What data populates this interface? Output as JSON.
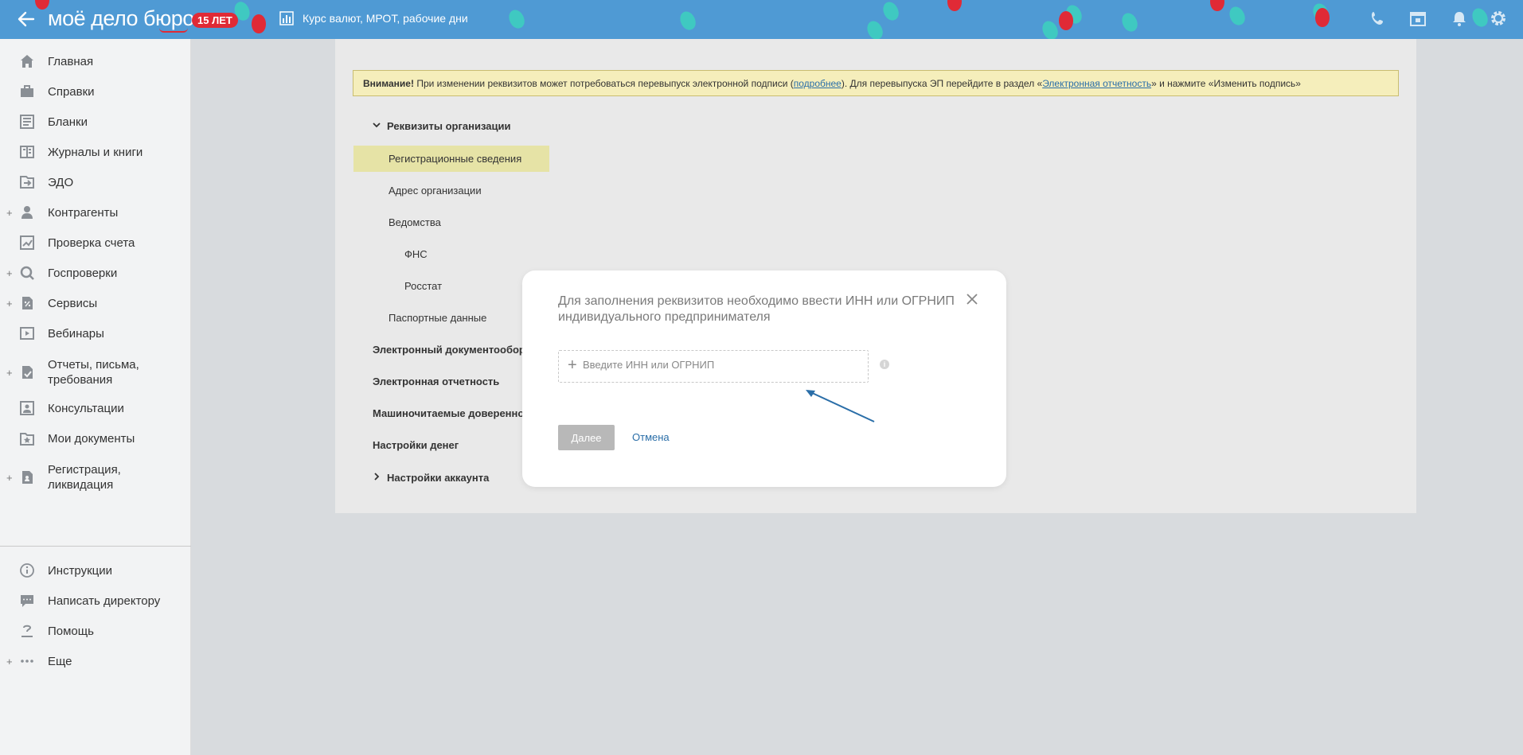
{
  "header": {
    "logo": "моё дело бюро",
    "anniversary_badge": "15 ЛЕТ",
    "link_label": "Курс валют, МРОТ, рабочие дни",
    "icons": [
      "back-arrow-icon",
      "chart-icon",
      "phone-icon",
      "calendar-icon",
      "bell-icon",
      "gear-icon"
    ]
  },
  "sidebar": {
    "items": [
      {
        "label": "Главная",
        "icon": "home-icon",
        "expandable": false
      },
      {
        "label": "Справки",
        "icon": "briefcase-icon",
        "expandable": false
      },
      {
        "label": "Бланки",
        "icon": "forms-icon",
        "expandable": false
      },
      {
        "label": "Журналы и книги",
        "icon": "journal-icon",
        "expandable": false
      },
      {
        "label": "ЭДО",
        "icon": "edo-icon",
        "expandable": false
      },
      {
        "label": "Контрагенты",
        "icon": "person-icon",
        "expandable": true
      },
      {
        "label": "Проверка счета",
        "icon": "account-check-icon",
        "expandable": false
      },
      {
        "label": "Госпроверки",
        "icon": "magnifier-icon",
        "expandable": true
      },
      {
        "label": "Сервисы",
        "icon": "percent-doc-icon",
        "expandable": true
      },
      {
        "label": "Вебинары",
        "icon": "video-icon",
        "expandable": false
      },
      {
        "label": "Отчеты, письма, требования",
        "icon": "report-icon",
        "expandable": true
      },
      {
        "label": "Консультации",
        "icon": "consult-icon",
        "expandable": false
      },
      {
        "label": "Мои документы",
        "icon": "folder-star-icon",
        "expandable": false
      },
      {
        "label": "Регистрация, ликвидация",
        "icon": "registration-icon",
        "expandable": true
      }
    ],
    "bottom_items": [
      {
        "label": "Инструкции",
        "icon": "info-circle-icon",
        "expandable": false
      },
      {
        "label": "Написать директору",
        "icon": "message-icon",
        "expandable": false
      },
      {
        "label": "Помощь",
        "icon": "help-icon",
        "expandable": false
      },
      {
        "label": "Еще",
        "icon": "more-dots-icon",
        "expandable": true
      }
    ]
  },
  "warning": {
    "bold": "Внимание!",
    "text1": " При изменении реквизитов может потребоваться перевыпуск электронной подписи (",
    "link1": "подробнее",
    "text2": "). Для перевыпуска ЭП перейдите в раздел «",
    "link2": "Электронная отчетность",
    "text3": "» и нажмите «Изменить подпись»"
  },
  "tree": {
    "org_requisites": "Реквизиты организации",
    "reg_info": "Регистрационные сведения",
    "org_address": "Адрес организации",
    "departments": "Ведомства",
    "fns": "ФНС",
    "rosstat": "Росстат",
    "passport": "Паспортные данные",
    "edo": "Электронный документооборот",
    "e_reporting": "Электронная отчетность",
    "machine_poa": "Машиночитаемые доверенности",
    "money_settings": "Настройки денег",
    "account_settings": "Настройки аккаунта"
  },
  "modal": {
    "title": "Для заполнения реквизитов необходимо ввести ИНН или ОГРНИП индивидуального предпринимателя",
    "input_placeholder": "Введите ИНН или ОГРНИП",
    "input_value": "",
    "next_label": "Далее",
    "cancel_label": "Отмена"
  },
  "colors": {
    "header_bg": "#4f9ad4",
    "badge_red": "#e02a36",
    "warning_bg": "#f5eebb",
    "active_item_bg": "#e6e3a6",
    "link": "#2a6ea8",
    "arrow": "#2a6ea8"
  }
}
